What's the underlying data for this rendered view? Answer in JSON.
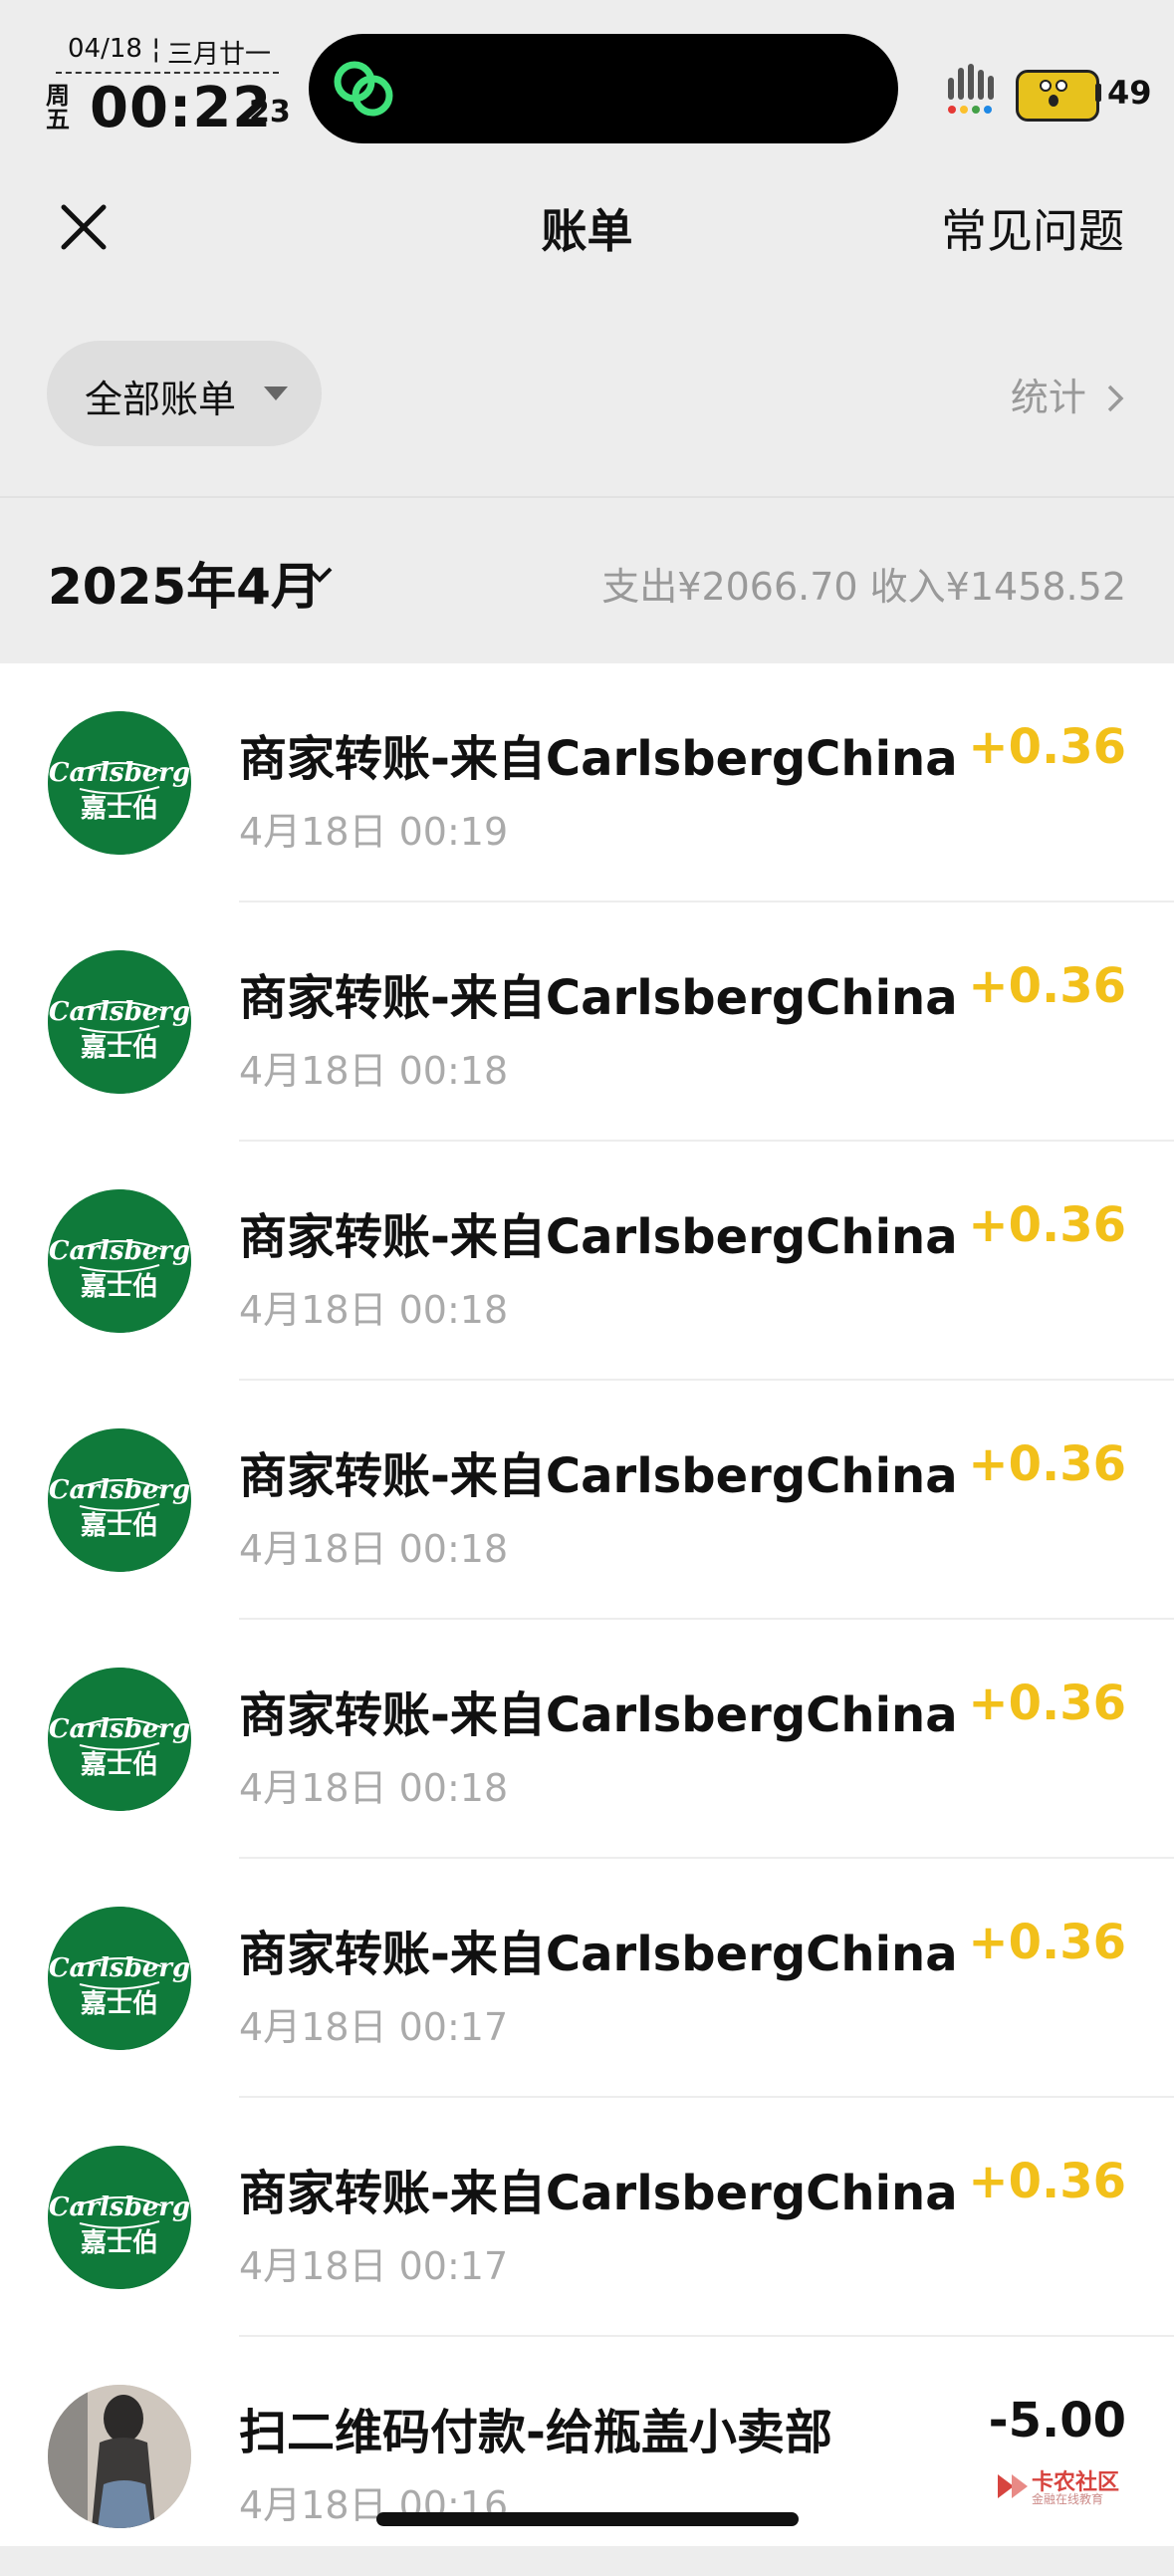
{
  "status": {
    "date": "04/18",
    "lunar": "三月廿一",
    "weekday": "周五",
    "clock": "00:22",
    "seconds": "23",
    "battery": "49"
  },
  "nav": {
    "title": "账单",
    "faq": "常见问题"
  },
  "filter": {
    "label": "全部账单",
    "stats": "统计"
  },
  "month": {
    "label": "2025年4月",
    "summary": "支出¥2066.70   收入¥1458.52"
  },
  "transactions": [
    {
      "title": "商家转账-来自CarlsbergChina",
      "time": "4月18日 00:19",
      "amount": "+0.36"
    },
    {
      "title": "商家转账-来自CarlsbergChina",
      "time": "4月18日 00:18",
      "amount": "+0.36"
    },
    {
      "title": "商家转账-来自CarlsbergChina",
      "time": "4月18日 00:18",
      "amount": "+0.36"
    },
    {
      "title": "商家转账-来自CarlsbergChina",
      "time": "4月18日 00:18",
      "amount": "+0.36"
    },
    {
      "title": "商家转账-来自CarlsbergChina",
      "time": "4月18日 00:18",
      "amount": "+0.36"
    },
    {
      "title": "商家转账-来自CarlsbergChina",
      "time": "4月18日 00:17",
      "amount": "+0.36"
    },
    {
      "title": "商家转账-来自CarlsbergChina",
      "time": "4月18日 00:17",
      "amount": "+0.36"
    },
    {
      "title": "扫二维码付款-给瓶盖小卖部",
      "time": "4月18日 00:16",
      "amount": "-5.00"
    }
  ],
  "logo": {
    "brand": "Carlsberg",
    "cn": "嘉士伯"
  },
  "watermark": {
    "name": "卡农社区",
    "sub": "金融在线教育"
  },
  "colors": {
    "income": "#f2c01a",
    "carlsberg_green": "#0f7a3a",
    "background": "#ededed"
  }
}
